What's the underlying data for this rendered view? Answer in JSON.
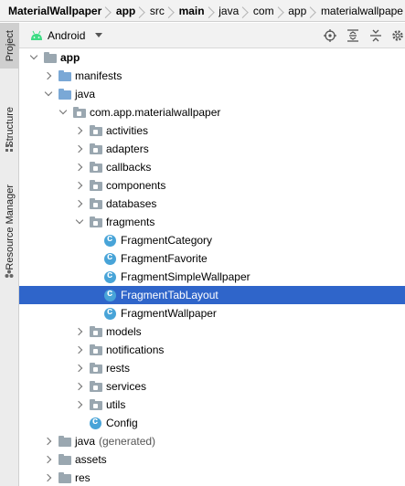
{
  "breadcrumb": {
    "items": [
      {
        "label": "MaterialWallpaper",
        "bold": true
      },
      {
        "label": "app",
        "bold": true
      },
      {
        "label": "src",
        "bold": false
      },
      {
        "label": "main",
        "bold": true
      },
      {
        "label": "java",
        "bold": false
      },
      {
        "label": "com",
        "bold": false
      },
      {
        "label": "app",
        "bold": false
      },
      {
        "label": "materialwallpape",
        "bold": false
      }
    ]
  },
  "toolstrip": {
    "tabs": [
      {
        "label": "Project",
        "active": true
      },
      {
        "label": "Structure",
        "active": false
      },
      {
        "label": "Resource Manager",
        "active": false
      }
    ]
  },
  "panel": {
    "view_selector": "Android",
    "tools": [
      "target-icon",
      "expand-all-icon",
      "collapse-all-icon",
      "gear-icon"
    ]
  },
  "tree": {
    "rows": [
      {
        "label": "app",
        "bold": true,
        "depth": 0,
        "expand": "down",
        "icon": "module"
      },
      {
        "label": "manifests",
        "depth": 1,
        "expand": "right",
        "icon": "folder-blue"
      },
      {
        "label": "java",
        "depth": 1,
        "expand": "down",
        "icon": "folder-blue"
      },
      {
        "label": "com.app.materialwallpaper",
        "depth": 2,
        "expand": "down",
        "icon": "package"
      },
      {
        "label": "activities",
        "depth": 3,
        "expand": "right",
        "icon": "package"
      },
      {
        "label": "adapters",
        "depth": 3,
        "expand": "right",
        "icon": "package"
      },
      {
        "label": "callbacks",
        "depth": 3,
        "expand": "right",
        "icon": "package"
      },
      {
        "label": "components",
        "depth": 3,
        "expand": "right",
        "icon": "package"
      },
      {
        "label": "databases",
        "depth": 3,
        "expand": "right",
        "icon": "package"
      },
      {
        "label": "fragments",
        "depth": 3,
        "expand": "down",
        "icon": "package"
      },
      {
        "label": "FragmentCategory",
        "depth": 4,
        "expand": "none",
        "icon": "class"
      },
      {
        "label": "FragmentFavorite",
        "depth": 4,
        "expand": "none",
        "icon": "class"
      },
      {
        "label": "FragmentSimpleWallpaper",
        "depth": 4,
        "expand": "none",
        "icon": "class"
      },
      {
        "label": "FragmentTabLayout",
        "depth": 4,
        "expand": "none",
        "icon": "class",
        "selected": true
      },
      {
        "label": "FragmentWallpaper",
        "depth": 4,
        "expand": "none",
        "icon": "class"
      },
      {
        "label": "models",
        "depth": 3,
        "expand": "right",
        "icon": "package"
      },
      {
        "label": "notifications",
        "depth": 3,
        "expand": "right",
        "icon": "package"
      },
      {
        "label": "rests",
        "depth": 3,
        "expand": "right",
        "icon": "package"
      },
      {
        "label": "services",
        "depth": 3,
        "expand": "right",
        "icon": "package"
      },
      {
        "label": "utils",
        "depth": 3,
        "expand": "right",
        "icon": "package"
      },
      {
        "label": "Config",
        "depth": 3,
        "expand": "none",
        "icon": "class"
      },
      {
        "label": "java",
        "suffix": "(generated)",
        "depth": 1,
        "expand": "right",
        "icon": "folder-gen"
      },
      {
        "label": "assets",
        "depth": 1,
        "expand": "right",
        "icon": "res"
      },
      {
        "label": "res",
        "depth": 1,
        "expand": "right",
        "icon": "res"
      }
    ]
  },
  "colors": {
    "selection": "#2f65ca",
    "class_icon": "#48a4d8",
    "folder": "#9aa7b0",
    "folder_blue": "#7aa8d6"
  }
}
